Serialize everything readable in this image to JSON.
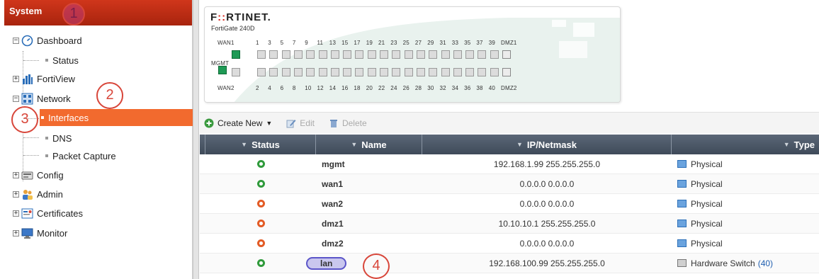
{
  "sidebar": {
    "header": "System",
    "items": [
      {
        "label": "Dashboard"
      },
      {
        "label": "Status"
      },
      {
        "label": "FortiView"
      },
      {
        "label": "Network"
      },
      {
        "label": "Interfaces"
      },
      {
        "label": "DNS"
      },
      {
        "label": "Packet Capture"
      },
      {
        "label": "Config"
      },
      {
        "label": "Admin"
      },
      {
        "label": "Certificates"
      },
      {
        "label": "Monitor"
      }
    ]
  },
  "annotations": [
    "1",
    "2",
    "3",
    "4"
  ],
  "device": {
    "brand_a": "F",
    "brand_b": "::",
    "brand_c": "RTINET.",
    "model": "FortiGate 240D",
    "mgmt_label": "MGMT",
    "top_labels": [
      "WAN1",
      "1",
      "3",
      "5",
      "7",
      "9",
      "11",
      "13",
      "15",
      "17",
      "19",
      "21",
      "23",
      "25",
      "27",
      "29",
      "31",
      "33",
      "35",
      "37",
      "39",
      "DMZ1"
    ],
    "bottom_labels": [
      "WAN2",
      "2",
      "4",
      "6",
      "8",
      "10",
      "12",
      "14",
      "16",
      "18",
      "20",
      "22",
      "24",
      "26",
      "28",
      "30",
      "32",
      "34",
      "36",
      "38",
      "40",
      "DMZ2"
    ]
  },
  "toolbar": {
    "create_new": "Create New",
    "edit": "Edit",
    "delete": "Delete"
  },
  "table": {
    "columns": [
      "Status",
      "Name",
      "IP/Netmask",
      "Type"
    ],
    "rows": [
      {
        "status": "up",
        "name": "mgmt",
        "ip": "192.168.1.99 255.255.255.0",
        "type": "Physical",
        "count": ""
      },
      {
        "status": "up",
        "name": "wan1",
        "ip": "0.0.0.0 0.0.0.0",
        "type": "Physical",
        "count": ""
      },
      {
        "status": "down",
        "name": "wan2",
        "ip": "0.0.0.0 0.0.0.0",
        "type": "Physical",
        "count": ""
      },
      {
        "status": "down",
        "name": "dmz1",
        "ip": "10.10.10.1 255.255.255.0",
        "type": "Physical",
        "count": ""
      },
      {
        "status": "down",
        "name": "dmz2",
        "ip": "0.0.0.0 0.0.0.0",
        "type": "Physical",
        "count": ""
      },
      {
        "status": "up",
        "name": "lan",
        "ip": "192.168.100.99 255.255.255.0",
        "type": "Hardware Switch",
        "count": "(40)"
      }
    ]
  },
  "colors": {
    "header_red": "#c2311a",
    "selected_orange": "#f26a2e",
    "annotation_red": "#d8463a",
    "table_header": "#4a5666",
    "status_up": "#2f9a3b",
    "status_down": "#e35b25"
  }
}
